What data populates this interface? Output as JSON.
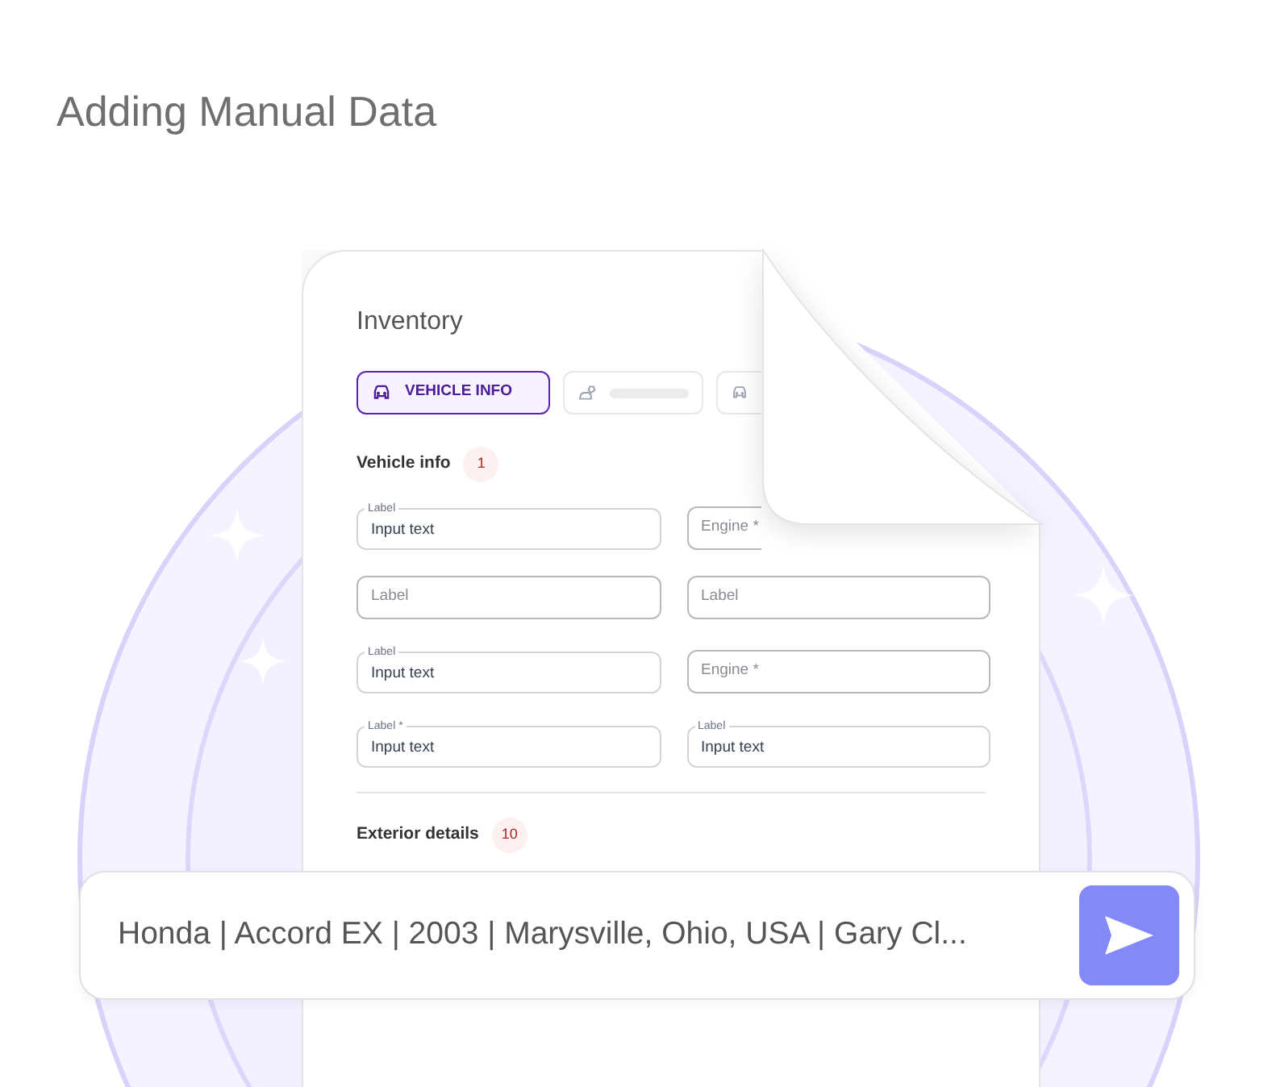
{
  "title": "Adding Manual Data",
  "card": {
    "title": "Inventory",
    "tabs": [
      {
        "label": "VEHICLE INFO",
        "selected": true,
        "kind": "text"
      },
      {
        "selected": false,
        "kind": "skeleton"
      },
      {
        "selected": false,
        "kind": "icon"
      }
    ],
    "sections": [
      {
        "heading": "Vehicle info",
        "count": "1",
        "fields": [
          {
            "kind": "filled",
            "label": "Label",
            "value": "Input text"
          },
          {
            "kind": "partial",
            "placeholder": "Engine *"
          },
          {
            "kind": "empty",
            "placeholder": "Label"
          },
          {
            "kind": "empty",
            "placeholder": "Label"
          },
          {
            "kind": "filled",
            "label": "Label",
            "value": "Input text"
          },
          {
            "kind": "empty",
            "placeholder": "Engine *"
          },
          {
            "kind": "filled",
            "label": "Label *",
            "value": "Input text"
          },
          {
            "kind": "filled",
            "label": "Label",
            "value": "Input text"
          }
        ]
      },
      {
        "heading": "Exterior details",
        "count": "10"
      }
    ]
  },
  "prompt": {
    "value": "Honda | Accord EX | 2003 | Marysville, Ohio, USA | Gary Cl..."
  }
}
